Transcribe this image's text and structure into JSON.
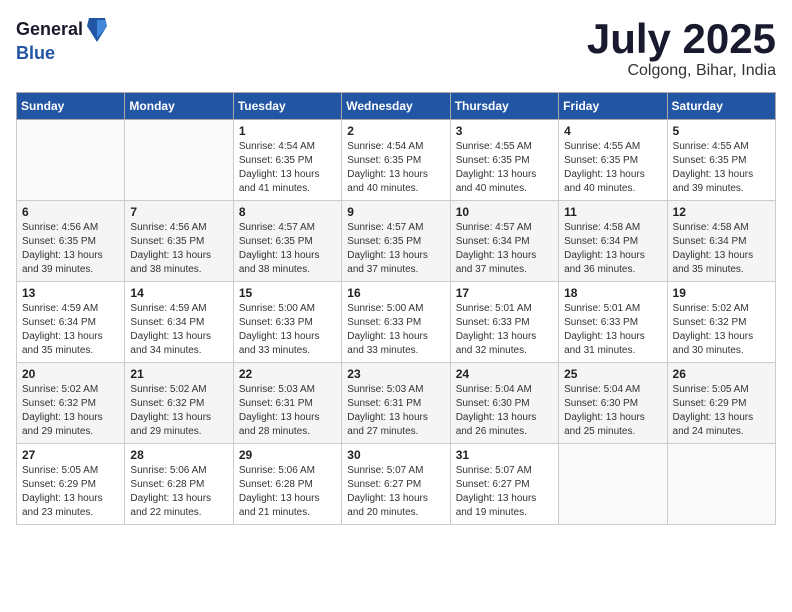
{
  "header": {
    "logo": {
      "general": "General",
      "blue": "Blue"
    },
    "title": "July 2025",
    "location": "Colgong, Bihar, India"
  },
  "calendar": {
    "days_of_week": [
      "Sunday",
      "Monday",
      "Tuesday",
      "Wednesday",
      "Thursday",
      "Friday",
      "Saturday"
    ],
    "weeks": [
      [
        {
          "day": "",
          "info": ""
        },
        {
          "day": "",
          "info": ""
        },
        {
          "day": "1",
          "info": "Sunrise: 4:54 AM\nSunset: 6:35 PM\nDaylight: 13 hours\nand 41 minutes."
        },
        {
          "day": "2",
          "info": "Sunrise: 4:54 AM\nSunset: 6:35 PM\nDaylight: 13 hours\nand 40 minutes."
        },
        {
          "day": "3",
          "info": "Sunrise: 4:55 AM\nSunset: 6:35 PM\nDaylight: 13 hours\nand 40 minutes."
        },
        {
          "day": "4",
          "info": "Sunrise: 4:55 AM\nSunset: 6:35 PM\nDaylight: 13 hours\nand 40 minutes."
        },
        {
          "day": "5",
          "info": "Sunrise: 4:55 AM\nSunset: 6:35 PM\nDaylight: 13 hours\nand 39 minutes."
        }
      ],
      [
        {
          "day": "6",
          "info": "Sunrise: 4:56 AM\nSunset: 6:35 PM\nDaylight: 13 hours\nand 39 minutes."
        },
        {
          "day": "7",
          "info": "Sunrise: 4:56 AM\nSunset: 6:35 PM\nDaylight: 13 hours\nand 38 minutes."
        },
        {
          "day": "8",
          "info": "Sunrise: 4:57 AM\nSunset: 6:35 PM\nDaylight: 13 hours\nand 38 minutes."
        },
        {
          "day": "9",
          "info": "Sunrise: 4:57 AM\nSunset: 6:35 PM\nDaylight: 13 hours\nand 37 minutes."
        },
        {
          "day": "10",
          "info": "Sunrise: 4:57 AM\nSunset: 6:34 PM\nDaylight: 13 hours\nand 37 minutes."
        },
        {
          "day": "11",
          "info": "Sunrise: 4:58 AM\nSunset: 6:34 PM\nDaylight: 13 hours\nand 36 minutes."
        },
        {
          "day": "12",
          "info": "Sunrise: 4:58 AM\nSunset: 6:34 PM\nDaylight: 13 hours\nand 35 minutes."
        }
      ],
      [
        {
          "day": "13",
          "info": "Sunrise: 4:59 AM\nSunset: 6:34 PM\nDaylight: 13 hours\nand 35 minutes."
        },
        {
          "day": "14",
          "info": "Sunrise: 4:59 AM\nSunset: 6:34 PM\nDaylight: 13 hours\nand 34 minutes."
        },
        {
          "day": "15",
          "info": "Sunrise: 5:00 AM\nSunset: 6:33 PM\nDaylight: 13 hours\nand 33 minutes."
        },
        {
          "day": "16",
          "info": "Sunrise: 5:00 AM\nSunset: 6:33 PM\nDaylight: 13 hours\nand 33 minutes."
        },
        {
          "day": "17",
          "info": "Sunrise: 5:01 AM\nSunset: 6:33 PM\nDaylight: 13 hours\nand 32 minutes."
        },
        {
          "day": "18",
          "info": "Sunrise: 5:01 AM\nSunset: 6:33 PM\nDaylight: 13 hours\nand 31 minutes."
        },
        {
          "day": "19",
          "info": "Sunrise: 5:02 AM\nSunset: 6:32 PM\nDaylight: 13 hours\nand 30 minutes."
        }
      ],
      [
        {
          "day": "20",
          "info": "Sunrise: 5:02 AM\nSunset: 6:32 PM\nDaylight: 13 hours\nand 29 minutes."
        },
        {
          "day": "21",
          "info": "Sunrise: 5:02 AM\nSunset: 6:32 PM\nDaylight: 13 hours\nand 29 minutes."
        },
        {
          "day": "22",
          "info": "Sunrise: 5:03 AM\nSunset: 6:31 PM\nDaylight: 13 hours\nand 28 minutes."
        },
        {
          "day": "23",
          "info": "Sunrise: 5:03 AM\nSunset: 6:31 PM\nDaylight: 13 hours\nand 27 minutes."
        },
        {
          "day": "24",
          "info": "Sunrise: 5:04 AM\nSunset: 6:30 PM\nDaylight: 13 hours\nand 26 minutes."
        },
        {
          "day": "25",
          "info": "Sunrise: 5:04 AM\nSunset: 6:30 PM\nDaylight: 13 hours\nand 25 minutes."
        },
        {
          "day": "26",
          "info": "Sunrise: 5:05 AM\nSunset: 6:29 PM\nDaylight: 13 hours\nand 24 minutes."
        }
      ],
      [
        {
          "day": "27",
          "info": "Sunrise: 5:05 AM\nSunset: 6:29 PM\nDaylight: 13 hours\nand 23 minutes."
        },
        {
          "day": "28",
          "info": "Sunrise: 5:06 AM\nSunset: 6:28 PM\nDaylight: 13 hours\nand 22 minutes."
        },
        {
          "day": "29",
          "info": "Sunrise: 5:06 AM\nSunset: 6:28 PM\nDaylight: 13 hours\nand 21 minutes."
        },
        {
          "day": "30",
          "info": "Sunrise: 5:07 AM\nSunset: 6:27 PM\nDaylight: 13 hours\nand 20 minutes."
        },
        {
          "day": "31",
          "info": "Sunrise: 5:07 AM\nSunset: 6:27 PM\nDaylight: 13 hours\nand 19 minutes."
        },
        {
          "day": "",
          "info": ""
        },
        {
          "day": "",
          "info": ""
        }
      ]
    ]
  }
}
